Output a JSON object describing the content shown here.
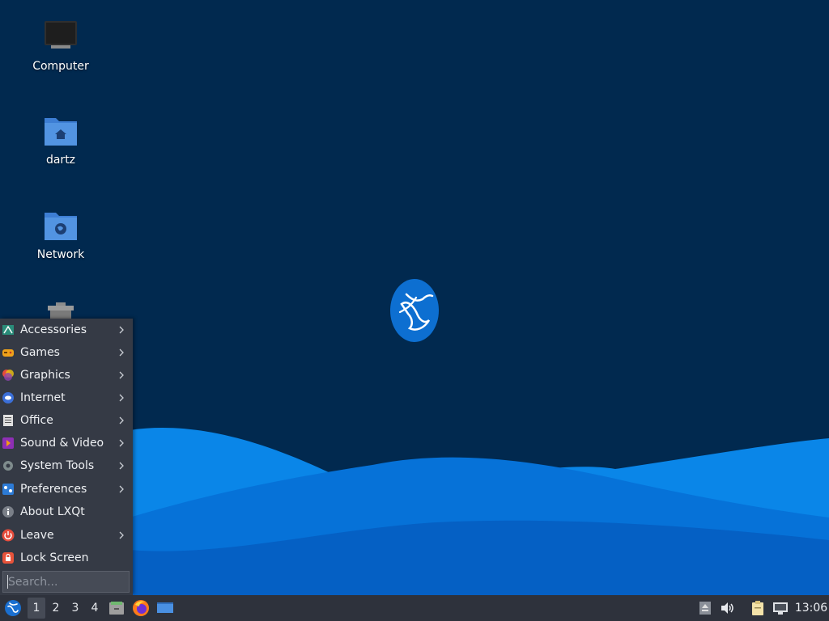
{
  "desktop": {
    "icons": [
      {
        "label": "Computer",
        "icon": "computer-icon"
      },
      {
        "label": "dartz",
        "icon": "home-folder-icon"
      },
      {
        "label": "Network",
        "icon": "network-folder-icon"
      },
      {
        "label": "",
        "icon": "trash-icon"
      }
    ],
    "logo": "lubuntu-logo",
    "colors": {
      "background": "#01294f",
      "wave_light": "#0a86e8",
      "wave_mid": "#0568cc",
      "wave_dark": "#0552b0"
    }
  },
  "start_menu": {
    "items": [
      {
        "label": "Accessories",
        "icon": "accessories-icon",
        "submenu": true
      },
      {
        "label": "Games",
        "icon": "games-icon",
        "submenu": true
      },
      {
        "label": "Graphics",
        "icon": "graphics-icon",
        "submenu": true
      },
      {
        "label": "Internet",
        "icon": "internet-icon",
        "submenu": true
      },
      {
        "label": "Office",
        "icon": "office-icon",
        "submenu": true
      },
      {
        "label": "Sound & Video",
        "icon": "sound-video-icon",
        "submenu": true
      },
      {
        "label": "System Tools",
        "icon": "system-tools-icon",
        "submenu": true
      },
      {
        "label": "Preferences",
        "icon": "preferences-icon",
        "submenu": true
      },
      {
        "label": "About LXQt",
        "icon": "info-icon",
        "submenu": false
      },
      {
        "label": "Leave",
        "icon": "power-icon",
        "submenu": true
      },
      {
        "label": "Lock Screen",
        "icon": "lock-icon",
        "submenu": false
      }
    ],
    "search": {
      "placeholder": "Search...",
      "value": ""
    }
  },
  "taskbar": {
    "start_icon": "lubuntu-start-icon",
    "workspaces": [
      "1",
      "2",
      "3",
      "4"
    ],
    "active_workspace": "1",
    "launchers": [
      "file-manager-icon",
      "firefox-icon",
      "show-desktop-icon"
    ],
    "tray": [
      "removable-media-icon",
      "volume-icon",
      "clipboard-icon",
      "network-wired-icon"
    ],
    "clock": "13:06"
  }
}
